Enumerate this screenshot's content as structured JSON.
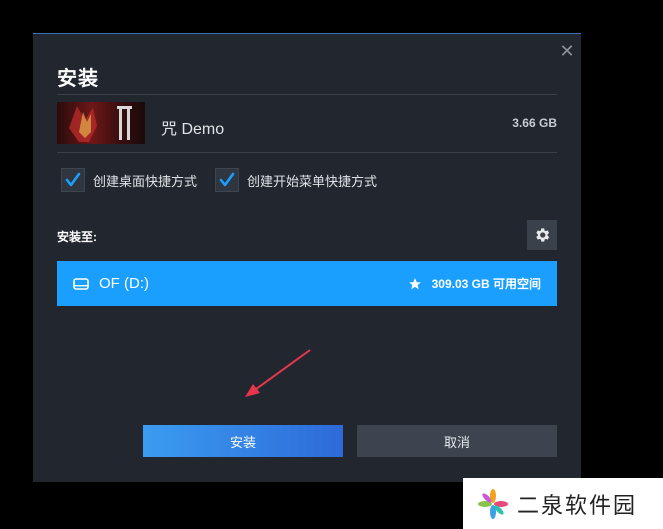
{
  "dialog": {
    "title": "安装",
    "close_glyph": "✕"
  },
  "game": {
    "name": "咒 Demo",
    "size": "3.66 GB"
  },
  "options": {
    "desktop_shortcut": {
      "label": "创建桌面快捷方式",
      "checked": true
    },
    "start_menu_shortcut": {
      "label": "创建开始菜单快捷方式",
      "checked": true
    }
  },
  "install_location": {
    "label": "安装至:",
    "drive_name": "OF (D:)",
    "free_space": "309.03 GB 可用空间"
  },
  "buttons": {
    "install": "安装",
    "cancel": "取消"
  },
  "watermark": {
    "text": "二泉软件园"
  },
  "colors": {
    "dialog_bg": "#22272f",
    "accent": "#1a9fff",
    "annotation_arrow": "#e8364d"
  },
  "icons": [
    "close-icon",
    "checkmark-icon",
    "gear-icon",
    "drive-icon",
    "star-icon",
    "logo-pinwheel-icon"
  ]
}
